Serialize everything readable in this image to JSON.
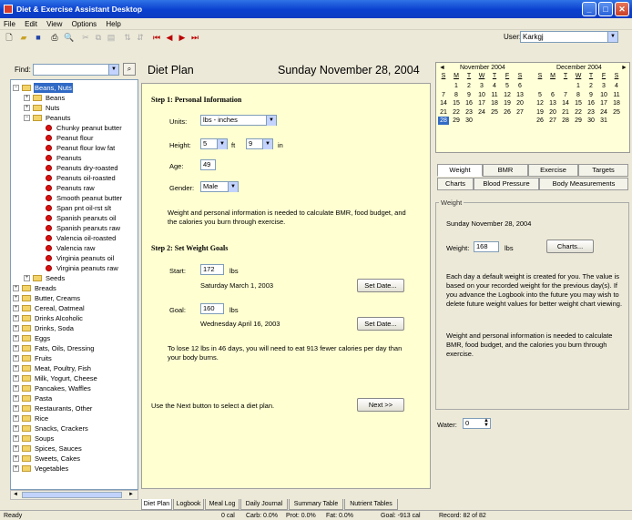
{
  "window": {
    "title": "Diet & Exercise Assistant Desktop",
    "min": "_",
    "max": "□",
    "close": "✕"
  },
  "menu": [
    "File",
    "Edit",
    "View",
    "Options",
    "Help"
  ],
  "toolbar": {
    "user_label": "User:",
    "user_value": "Karkgj"
  },
  "left": {
    "find_label": "Find:",
    "tree": [
      {
        "label": "Beans, Nuts",
        "level": 0,
        "type": "folder",
        "expanded": true,
        "selected": true
      },
      {
        "label": "Beans",
        "level": 1,
        "type": "folder",
        "expanded": false
      },
      {
        "label": "Nuts",
        "level": 1,
        "type": "folder",
        "expanded": false
      },
      {
        "label": "Peanuts",
        "level": 1,
        "type": "folder",
        "expanded": true
      },
      {
        "label": "Chunky peanut butter",
        "level": 2,
        "type": "food"
      },
      {
        "label": "Peanut flour",
        "level": 2,
        "type": "food"
      },
      {
        "label": "Peanut flour low fat",
        "level": 2,
        "type": "food"
      },
      {
        "label": "Peanuts",
        "level": 2,
        "type": "food"
      },
      {
        "label": "Peanuts dry-roasted",
        "level": 2,
        "type": "food"
      },
      {
        "label": "Peanuts oil-roasted",
        "level": 2,
        "type": "food"
      },
      {
        "label": "Peanuts raw",
        "level": 2,
        "type": "food"
      },
      {
        "label": "Smooth peanut butter",
        "level": 2,
        "type": "food"
      },
      {
        "label": "Span pnt oil-rst slt",
        "level": 2,
        "type": "food"
      },
      {
        "label": "Spanish peanuts oil",
        "level": 2,
        "type": "food"
      },
      {
        "label": "Spanish peanuts raw",
        "level": 2,
        "type": "food"
      },
      {
        "label": "Valencia oil-roasted",
        "level": 2,
        "type": "food"
      },
      {
        "label": "Valencia raw",
        "level": 2,
        "type": "food"
      },
      {
        "label": "Virginia peanuts oil",
        "level": 2,
        "type": "food"
      },
      {
        "label": "Virginia peanuts raw",
        "level": 2,
        "type": "food"
      },
      {
        "label": "Seeds",
        "level": 1,
        "type": "folder",
        "expanded": false
      },
      {
        "label": "Breads",
        "level": 0,
        "type": "folder",
        "expanded": false
      },
      {
        "label": "Butter, Creams",
        "level": 0,
        "type": "folder",
        "expanded": false
      },
      {
        "label": "Cereal, Oatmeal",
        "level": 0,
        "type": "folder",
        "expanded": false
      },
      {
        "label": "Drinks Alcoholic",
        "level": 0,
        "type": "folder",
        "expanded": false
      },
      {
        "label": "Drinks, Soda",
        "level": 0,
        "type": "folder",
        "expanded": false
      },
      {
        "label": "Eggs",
        "level": 0,
        "type": "folder",
        "expanded": false
      },
      {
        "label": "Fats, Oils, Dressing",
        "level": 0,
        "type": "folder",
        "expanded": false
      },
      {
        "label": "Fruits",
        "level": 0,
        "type": "folder",
        "expanded": false
      },
      {
        "label": "Meat, Poultry, Fish",
        "level": 0,
        "type": "folder",
        "expanded": false
      },
      {
        "label": "Milk, Yogurt, Cheese",
        "level": 0,
        "type": "folder",
        "expanded": false
      },
      {
        "label": "Pancakes, Waffles",
        "level": 0,
        "type": "folder",
        "expanded": false
      },
      {
        "label": "Pasta",
        "level": 0,
        "type": "folder",
        "expanded": false
      },
      {
        "label": "Restaurants, Other",
        "level": 0,
        "type": "folder",
        "expanded": false
      },
      {
        "label": "Rice",
        "level": 0,
        "type": "folder",
        "expanded": false
      },
      {
        "label": "Snacks, Crackers",
        "level": 0,
        "type": "folder",
        "expanded": false
      },
      {
        "label": "Soups",
        "level": 0,
        "type": "folder",
        "expanded": false
      },
      {
        "label": "Spices, Sauces",
        "level": 0,
        "type": "folder",
        "expanded": false
      },
      {
        "label": "Sweets, Cakes",
        "level": 0,
        "type": "folder",
        "expanded": false
      },
      {
        "label": "Vegetables",
        "level": 0,
        "type": "folder",
        "expanded": false
      }
    ]
  },
  "plan": {
    "title": "Diet Plan",
    "date": "Sunday November 28, 2004",
    "step1": {
      "header": "Step 1:  Personal Information",
      "units_label": "Units:",
      "units_value": "lbs - inches",
      "height_label": "Height:",
      "height_ft": "5",
      "ft_label": "ft",
      "height_in": "9",
      "in_label": "in",
      "age_label": "Age:",
      "age_value": "49",
      "gender_label": "Gender:",
      "gender_value": "Male",
      "note": "Weight and personal information is needed to calculate BMR, food budget, and the calories you burn through exercise."
    },
    "step2": {
      "header": "Step 2:  Set Weight Goals",
      "start_label": "Start:",
      "start_value": "172",
      "start_unit": "lbs",
      "start_date": "Saturday March 1, 2003",
      "goal_label": "Goal:",
      "goal_value": "160",
      "goal_unit": "lbs",
      "goal_date": "Wednesday April 16, 2003",
      "set_date_label": "Set Date...",
      "summary": "To lose 12 lbs in 46 days, you will need to eat 913 fewer calories per day than your body burns."
    },
    "next_hint": "Use the Next button to select a diet plan.",
    "next_label": "Next >>"
  },
  "bottom_tabs": [
    "Diet Plan",
    "Logbook",
    "Meal Log",
    "Daily Journal",
    "Summary Table",
    "Nutrient Tables"
  ],
  "calendar": {
    "left": {
      "month": "November 2004",
      "dow": [
        "S",
        "M",
        "T",
        "W",
        "T",
        "F",
        "S"
      ],
      "weeks": [
        [
          "",
          "1",
          "2",
          "3",
          "4",
          "5",
          "6"
        ],
        [
          "7",
          "8",
          "9",
          "10",
          "11",
          "12",
          "13"
        ],
        [
          "14",
          "15",
          "16",
          "17",
          "18",
          "19",
          "20"
        ],
        [
          "21",
          "22",
          "23",
          "24",
          "25",
          "26",
          "27"
        ],
        [
          "28",
          "29",
          "30",
          "",
          "",
          "",
          ""
        ]
      ]
    },
    "right": {
      "month": "December 2004",
      "dow": [
        "S",
        "M",
        "T",
        "W",
        "T",
        "F",
        "S"
      ],
      "weeks": [
        [
          "",
          "",
          "",
          "1",
          "2",
          "3",
          "4"
        ],
        [
          "5",
          "6",
          "7",
          "8",
          "9",
          "10",
          "11"
        ],
        [
          "12",
          "13",
          "14",
          "15",
          "16",
          "17",
          "18"
        ],
        [
          "19",
          "20",
          "21",
          "22",
          "23",
          "24",
          "25"
        ],
        [
          "26",
          "27",
          "28",
          "29",
          "30",
          "31",
          ""
        ]
      ]
    },
    "selected_day": "28",
    "prev": "◄",
    "next": "►"
  },
  "right_tabs_row1": [
    "Weight",
    "BMR",
    "Exercise",
    "Targets"
  ],
  "right_tabs_row2": [
    "Charts",
    "Blood Pressure",
    "Body Measurements"
  ],
  "weight": {
    "frame_title": "Weight",
    "date": "Sunday November 28, 2004",
    "weight_label": "Weight:",
    "weight_value": "168",
    "weight_unit": "lbs",
    "charts_label": "Charts...",
    "note1": "Each day a default weight is created for you.  The value is based on your recorded weight for the previous day(s).  If you advance the Logbook into the future you may wish to delete future weight values for better weight chart viewing.",
    "note2": "Weight and personal information is needed to calculate BMR, food budget, and the calories you burn through exercise."
  },
  "water": {
    "label": "Water:",
    "value": "0"
  },
  "status": {
    "ready": "Ready",
    "cal": "0 cal",
    "carb": "Carb: 0.0%",
    "prot": "Prot: 0.0%",
    "fat": "Fat: 0.0%",
    "goal": "Goal: -913 cal",
    "record": "Record: 82 of 82"
  }
}
